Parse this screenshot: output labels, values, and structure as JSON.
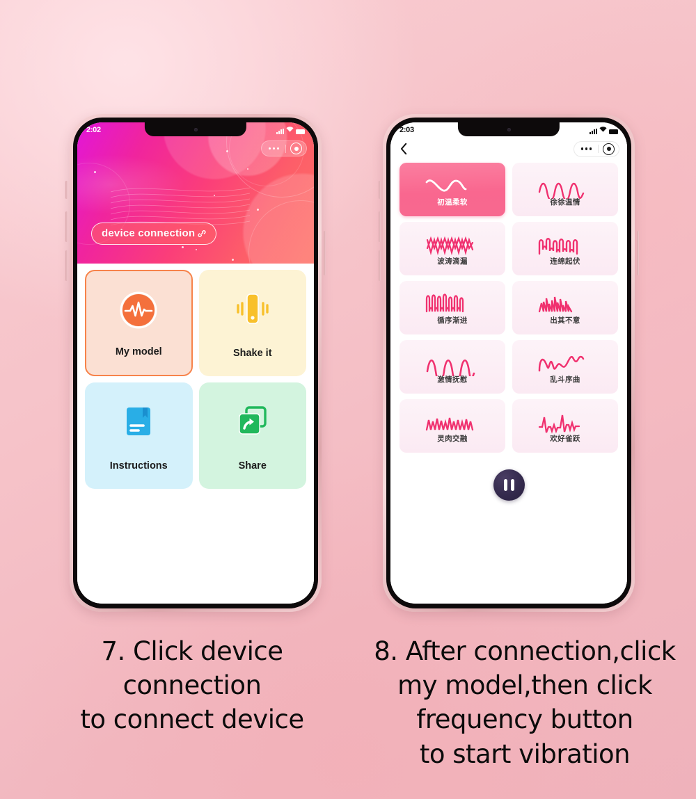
{
  "background": {
    "color": "#f5c3c9"
  },
  "colors": {
    "header_gradient_from": "#e216d8",
    "header_gradient_to": "#fe6f63",
    "accent_pink": "#f7688f",
    "selected_tile_border": "#f7834a",
    "pause_button": "#2a2040",
    "caption_text": "#0b0b0b"
  },
  "phone1": {
    "statusbar": {
      "time": "2:02",
      "signal_icon": "signal-bars-icon",
      "wifi_icon": "wifi-icon",
      "battery_icon": "battery-icon"
    },
    "capsule": {
      "menu_icon": "more-dots-icon",
      "target_icon": "target-icon"
    },
    "header": {
      "connection_label": "device connection",
      "link_icon": "link-icon"
    },
    "tiles": [
      {
        "label": "My model",
        "icon": "pulse-wave-icon",
        "selected": true,
        "bg": "#fbe0d3",
        "icon_color": "#f4703c"
      },
      {
        "label": "Shake it",
        "icon": "vibrate-phone-icon",
        "selected": false,
        "bg": "#fdf3d4",
        "icon_color": "#f8c02b"
      },
      {
        "label": "Instructions",
        "icon": "manual-book-icon",
        "selected": false,
        "bg": "#d4f1fb",
        "icon_color": "#29aee6"
      },
      {
        "label": "Share",
        "icon": "share-arrow-icon",
        "selected": false,
        "bg": "#d3f4df",
        "icon_color": "#21b85c"
      }
    ]
  },
  "phone2": {
    "statusbar": {
      "time": "2:03",
      "signal_icon": "signal-bars-icon",
      "wifi_icon": "wifi-icon",
      "battery_icon": "battery-icon"
    },
    "nav": {
      "back_icon": "back-chevron-icon",
      "menu_icon": "more-dots-icon",
      "target_icon": "target-icon"
    },
    "patterns": [
      {
        "label": "初温柔软",
        "waveform": "slow-smooth-s-curve",
        "active": true
      },
      {
        "label": "徐徐温情",
        "waveform": "gentle-rounded-sine",
        "active": false
      },
      {
        "label": "波涛滴漏",
        "waveform": "dense-zigzag-double",
        "active": false
      },
      {
        "label": "连绵起伏",
        "waveform": "square-top-ripple",
        "active": false
      },
      {
        "label": "循序渐进",
        "waveform": "tall-narrow-spikes",
        "active": false
      },
      {
        "label": "出其不意",
        "waveform": "irregular-sharp-peaks",
        "active": false
      },
      {
        "label": "激情抚慰",
        "waveform": "wide-smooth-sine",
        "active": false
      },
      {
        "label": "乱斗序曲",
        "waveform": "chaotic-mixed-curve",
        "active": false
      },
      {
        "label": "灵肉交融",
        "waveform": "rapid-pointed-peaks",
        "active": false
      },
      {
        "label": "欢好雀跃",
        "waveform": "burst-pulse-spikes",
        "active": false
      }
    ],
    "pause_button": {
      "icon": "pause-icon",
      "label": ""
    }
  },
  "captions": {
    "step7": "7. Click device\nconnection\nto connect device",
    "step8": "8. After connection,click\nmy model,then click\nfrequency button\nto start vibration"
  }
}
